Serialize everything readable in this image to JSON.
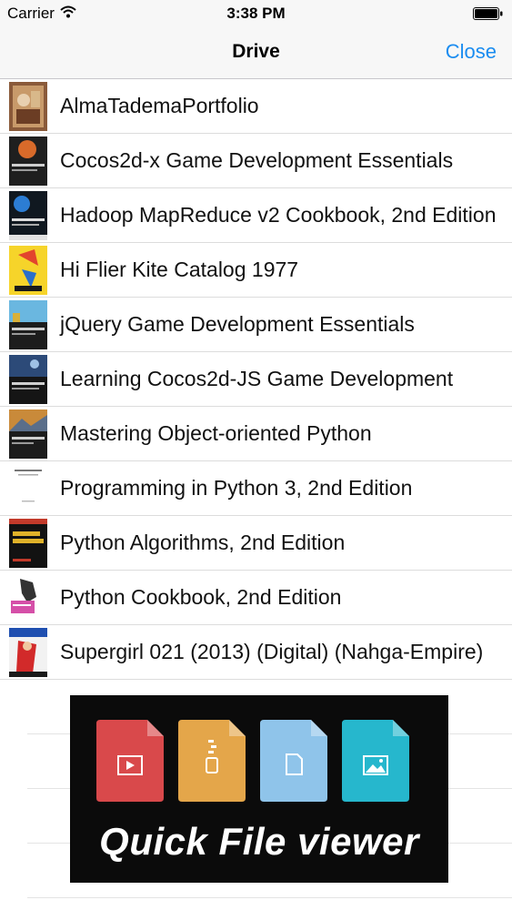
{
  "status_bar": {
    "carrier": "Carrier",
    "time": "3:38 PM"
  },
  "nav": {
    "title": "Drive",
    "close_label": "Close"
  },
  "colors": {
    "accent": "#1a8cf0"
  },
  "files": [
    {
      "name": "AlmaTademaPortfolio",
      "thumb": "painting"
    },
    {
      "name": "Cocos2d-x Game Development Essentials",
      "thumb": "dark-book"
    },
    {
      "name": "Hadoop MapReduce v2 Cookbook, 2nd Edition",
      "thumb": "blue-book"
    },
    {
      "name": "Hi Flier Kite Catalog 1977",
      "thumb": "yellow-catalog"
    },
    {
      "name": "jQuery Game Development Essentials",
      "thumb": "game-book"
    },
    {
      "name": "Learning Cocos2d-JS Game Development",
      "thumb": "dark-book-2"
    },
    {
      "name": "Mastering Object-oriented Python",
      "thumb": "landscape-book"
    },
    {
      "name": "Programming in Python 3, 2nd Edition",
      "thumb": "white-book"
    },
    {
      "name": "Python Algorithms, 2nd Edition",
      "thumb": "black-yellow-book"
    },
    {
      "name": "Python Cookbook, 2nd Edition",
      "thumb": "kangaroo-book"
    },
    {
      "name": "Supergirl 021 (2013) (Digital) (Nahga-Empire)",
      "thumb": "comic"
    }
  ],
  "banner": {
    "text": "Quick File viewer",
    "icons": [
      {
        "name": "video-file-icon",
        "color": "#d9494b"
      },
      {
        "name": "zip-file-icon",
        "color": "#e4a64a"
      },
      {
        "name": "document-file-icon",
        "color": "#8fc4ea"
      },
      {
        "name": "image-file-icon",
        "color": "#26b7cd"
      }
    ]
  }
}
